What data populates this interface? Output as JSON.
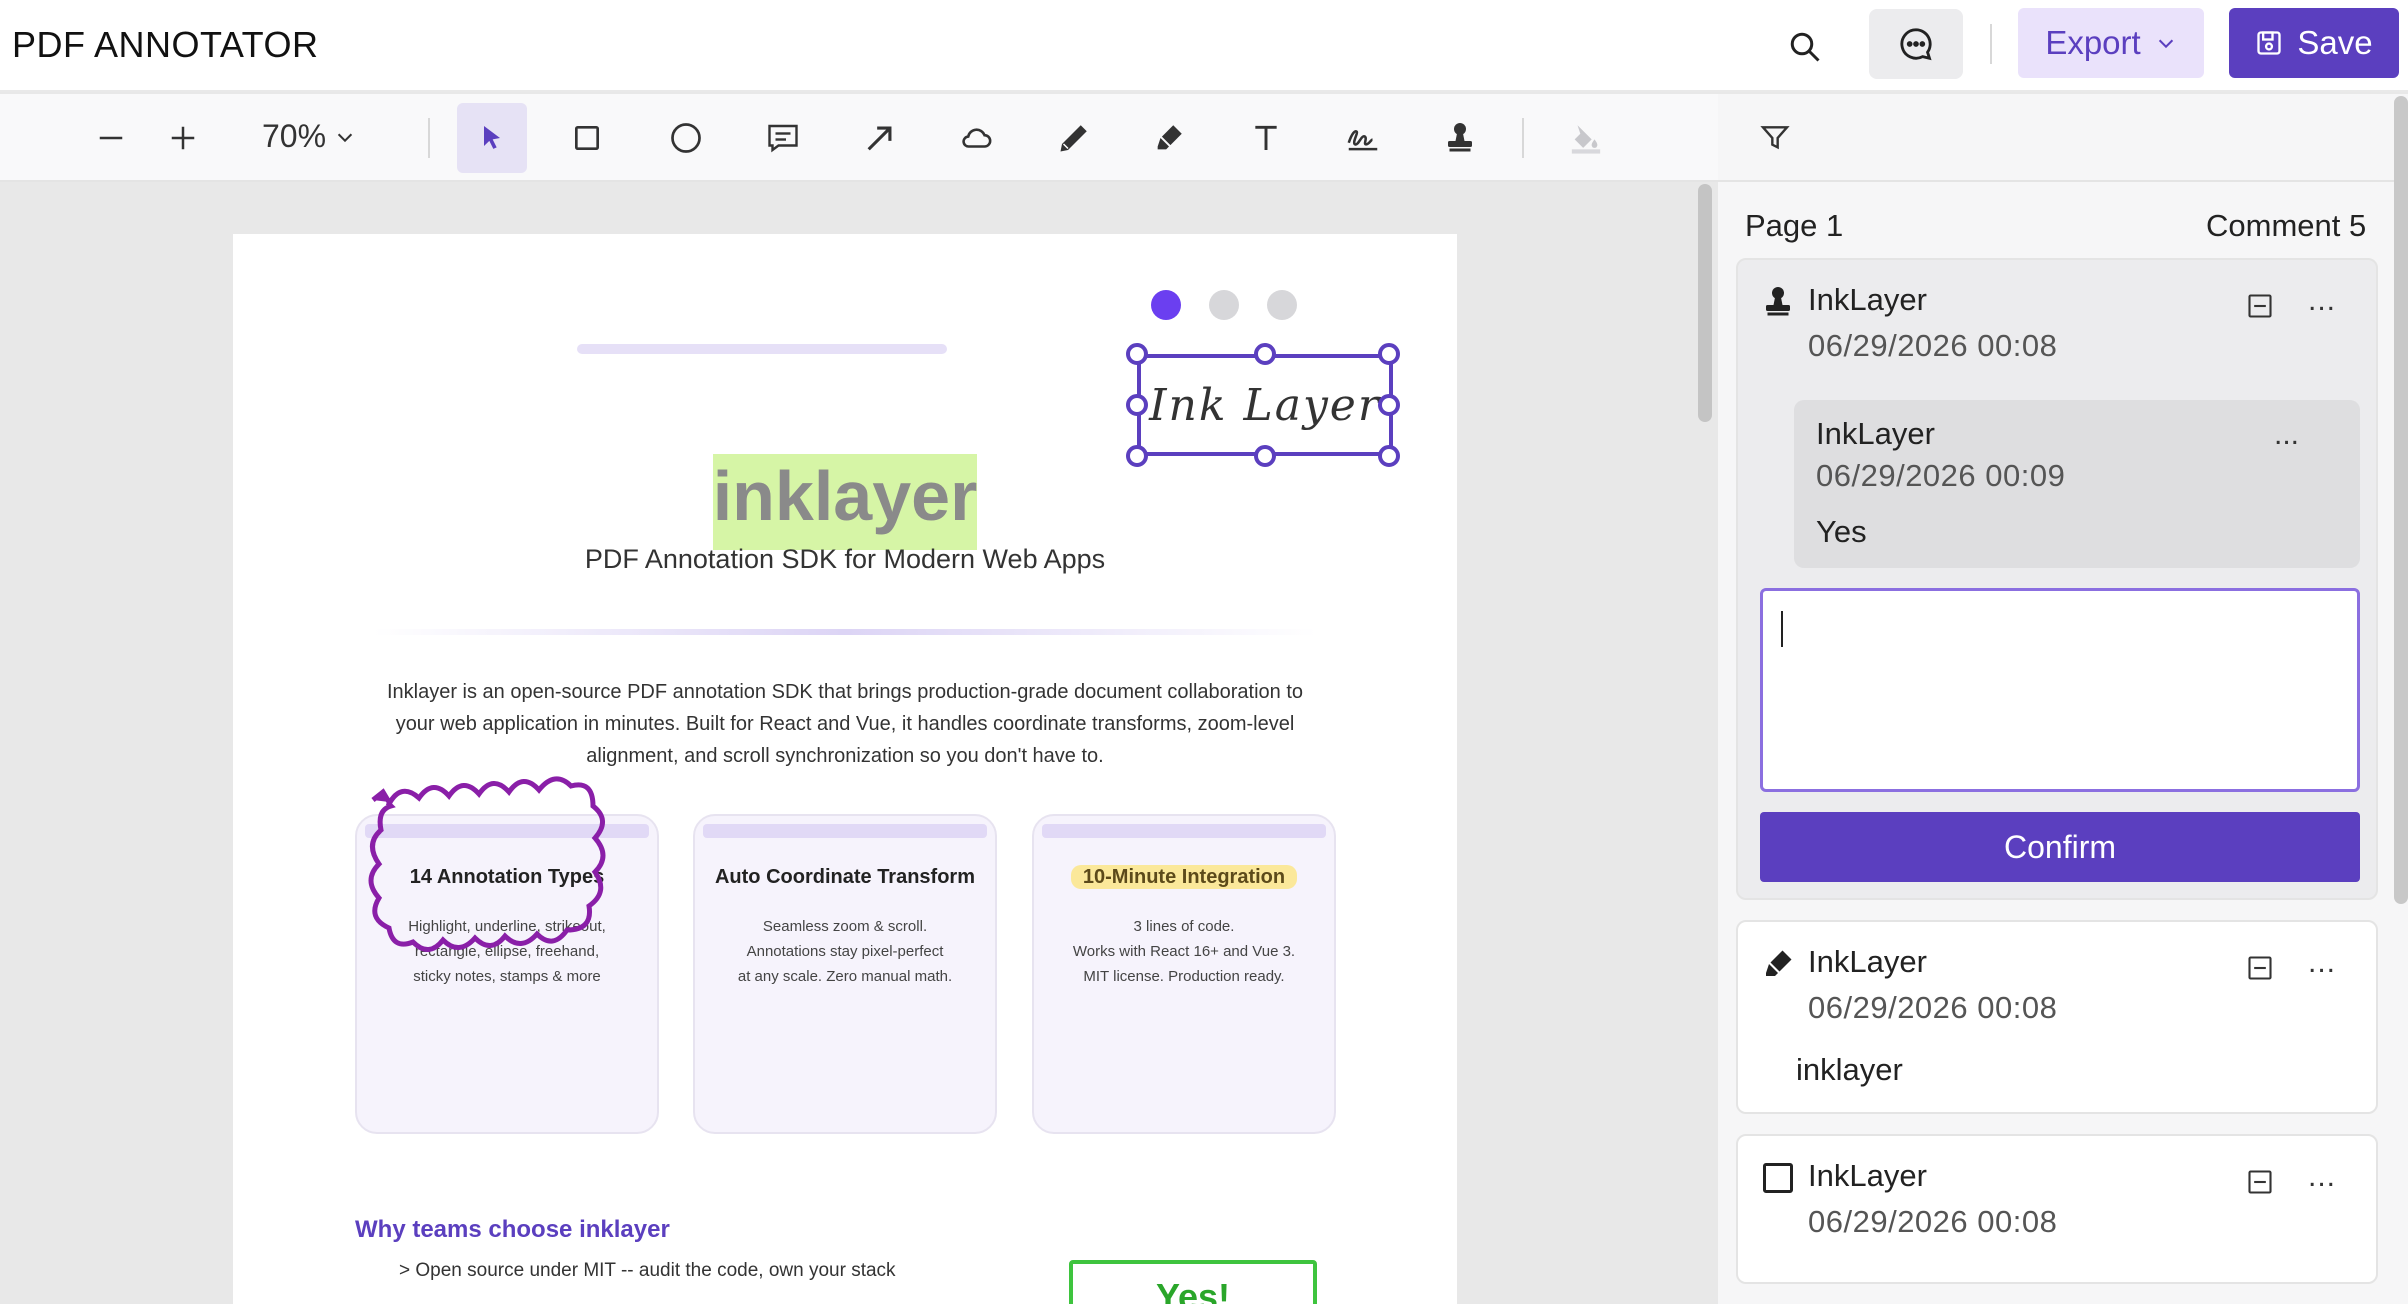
{
  "header": {
    "title": "PDF ANNOTATOR",
    "export_label": "Export",
    "save_label": "Save"
  },
  "toolbar": {
    "zoom": "70%",
    "tools": [
      "zoom-out",
      "zoom-in",
      "select",
      "rectangle",
      "ellipse",
      "note",
      "arrow",
      "cloud",
      "pencil",
      "highlighter",
      "text",
      "signature",
      "stamp",
      "fill-color"
    ],
    "active_tool": "select"
  },
  "document": {
    "ink_signature": "Ink Layer",
    "brand": "inklayer",
    "subtitle": "PDF Annotation SDK for Modern Web Apps",
    "description": [
      "Inklayer is an open-source PDF annotation SDK that brings production-grade document collaboration to",
      "your web application in minutes. Built for React and Vue, it handles coordinate transforms, zoom-level",
      "alignment, and scroll synchronization so you don't have to."
    ],
    "cards": [
      {
        "title": "14 Annotation Types",
        "lines": [
          "Highlight, underline, strikeout,",
          "rectangle, ellipse, freehand,",
          "sticky notes, stamps & more"
        ]
      },
      {
        "title": "Auto Coordinate Transform",
        "lines": [
          "Seamless zoom & scroll.",
          "Annotations stay pixel-perfect",
          "at any scale. Zero manual math."
        ]
      },
      {
        "title": "10-Minute Integration",
        "lines": [
          "3 lines of code.",
          "Works with React 16+ and Vue 3.",
          "MIT license. Production ready."
        ]
      }
    ],
    "why_heading": "Why teams choose inklayer",
    "why_item": "> Open source under MIT -- audit the code, own your stack",
    "yes_stamp": "Yes!"
  },
  "panel": {
    "page_label": "Page 1",
    "count_label": "Comment 5",
    "comments": [
      {
        "icon": "stamp-icon",
        "author": "InkLayer",
        "date": "06/29/2026 00:08",
        "more": "...",
        "reply": {
          "author": "InkLayer",
          "date": "06/29/2026 00:09",
          "text": "Yes",
          "more": "..."
        },
        "input_value": "",
        "confirm_label": "Confirm"
      },
      {
        "icon": "highlighter-icon",
        "author": "InkLayer",
        "date": "06/29/2026 00:08",
        "text": "inklayer",
        "more": "..."
      },
      {
        "icon": "rectangle-icon",
        "author": "InkLayer",
        "date": "06/29/2026 00:08",
        "more": "..."
      }
    ]
  },
  "colors": {
    "accent": "#5b3fbf",
    "accent_light": "#eae2fb",
    "highlight_green": "#d6f5a6",
    "stamp_green": "#3ec43e",
    "dot_active": "#6b3ff0"
  }
}
